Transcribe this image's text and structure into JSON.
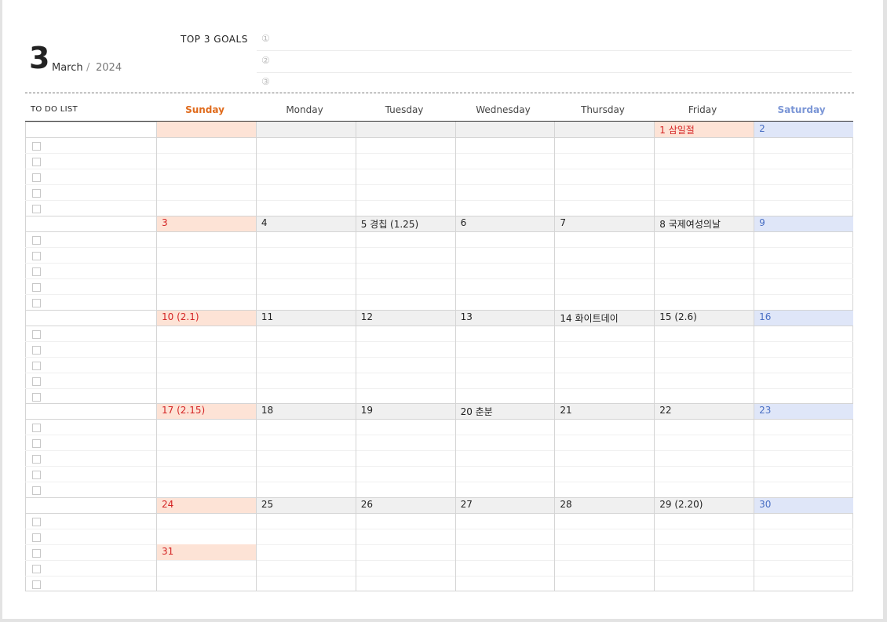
{
  "header": {
    "month_number": "3",
    "month_name": "March",
    "separator": "/",
    "year": "2024",
    "goals_label": "TOP 3 GOALS",
    "goal_markers": [
      "①",
      "②",
      "③"
    ],
    "todo_label": "TO DO LIST"
  },
  "weekdays": [
    "Sunday",
    "Monday",
    "Tuesday",
    "Wednesday",
    "Thursday",
    "Friday",
    "Saturday"
  ],
  "weekday_colors": {
    "Sunday": "#e06b1c",
    "Saturday": "#7b96d6",
    "default": "#444444"
  },
  "weeks": [
    [
      "",
      "",
      "",
      "",
      "",
      "1  삼일절",
      "2"
    ],
    [
      "3",
      "4",
      "5  경칩  (1.25)",
      "6",
      "7",
      "8  국제여성의날",
      "9"
    ],
    [
      "10  (2.1)",
      "11",
      "12",
      "13",
      "14  화이트데이",
      "15  (2.6)",
      "16"
    ],
    [
      "17  (2.15)",
      "18",
      "19",
      "20  춘분",
      "21",
      "22",
      "23"
    ],
    [
      "24",
      "25",
      "26",
      "27",
      "28",
      "29  (2.20)",
      "30"
    ]
  ],
  "extra_days": [
    {
      "week": 4,
      "day": 0,
      "label": "31"
    }
  ],
  "holidays": [
    {
      "week": 0,
      "day": 5
    }
  ],
  "colors": {
    "sunday_bg": "#fde3d6",
    "saturday_bg": "#dfe6f8",
    "weekday_bg": "#f0f0f0",
    "holiday_text": "#d42424",
    "saturday_text": "#4a6fc4"
  }
}
